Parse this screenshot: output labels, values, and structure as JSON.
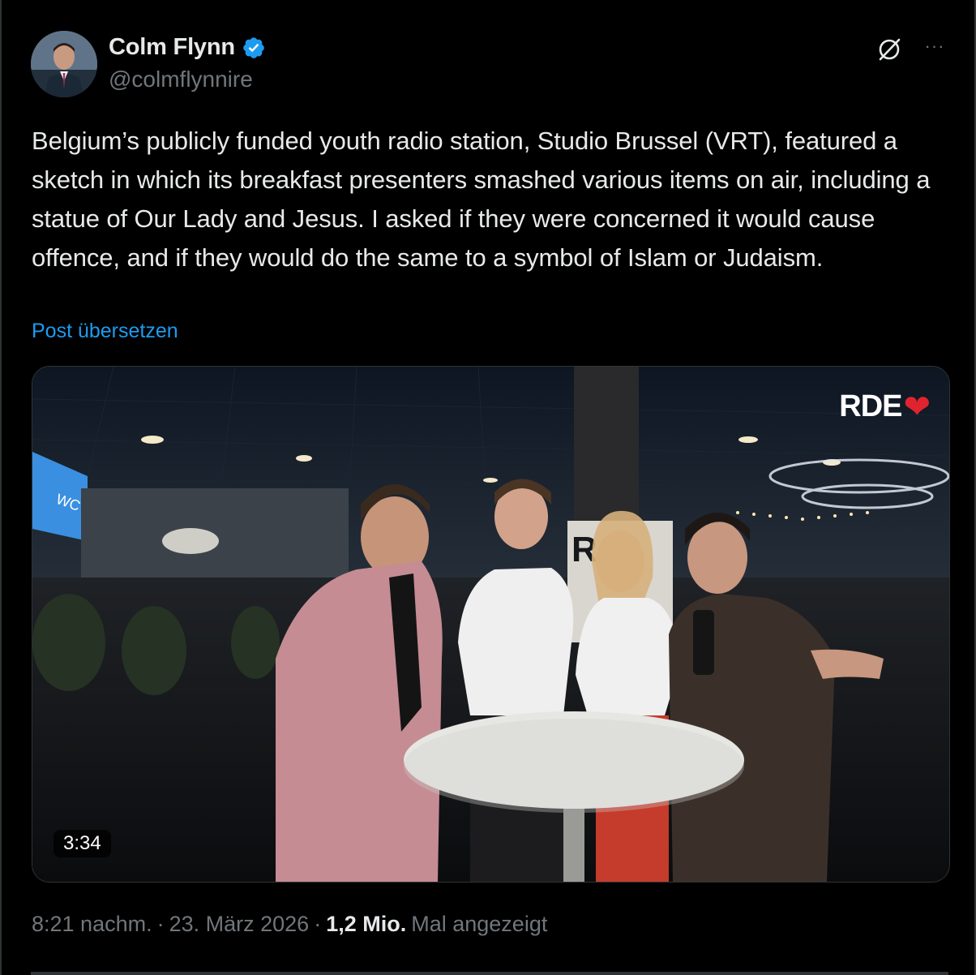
{
  "author": {
    "display_name": "Colm Flynn",
    "handle": "@colmflynnire",
    "verified": true
  },
  "header_icons": {
    "grok": "grok-icon",
    "more": "more-icon",
    "more_glyph": "···"
  },
  "tweet": {
    "text": "Belgium’s publicly funded youth radio station, Studio Brussel (VRT), featured a sketch in which its breakfast presenters smashed various items on air, including a statue of Our Lady and Jesus. I asked if they were concerned it would cause offence, and if they would do the same to a symbol of Islam or Judaism.",
    "translate_label": "Post übersetzen"
  },
  "media": {
    "type": "video",
    "logo_text": "RDE",
    "logo_heart": "❤",
    "duration": "3:34"
  },
  "meta": {
    "time": "8:21 nachm.",
    "separator": "·",
    "date": "23. März 2026",
    "views": "1,2 Mio.",
    "views_label": "Mal angezeigt"
  },
  "colors": {
    "background": "#000000",
    "text": "#e7e9ea",
    "secondary": "#71767b",
    "link": "#1d9bf0",
    "verified": "#1d9bf0",
    "heart": "#e0242f"
  }
}
